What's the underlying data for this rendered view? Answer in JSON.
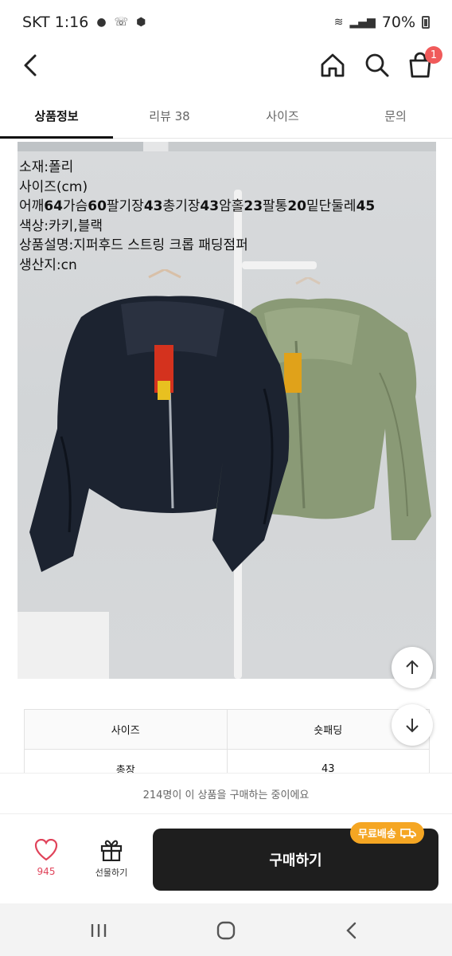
{
  "status_bar": {
    "carrier_time": "SKT 1:16",
    "battery": "70%"
  },
  "header": {
    "cart_count": "1"
  },
  "tabs": [
    {
      "label": "상품정보",
      "active": true
    },
    {
      "label": "리뷰 38",
      "active": false
    },
    {
      "label": "사이즈",
      "active": false
    },
    {
      "label": "문의",
      "active": false
    }
  ],
  "product_info": {
    "material": "소재:폴리",
    "size": "사이즈(cm)",
    "measure": {
      "l1": "어깨",
      "v1": "64",
      "l2": "가슴",
      "v2": "60",
      "l3": "팔기장",
      "v3": "43",
      "l4": "총기장",
      "v4": "43",
      "l5": "암홀",
      "v5": "23",
      "l6": "팔통",
      "v6": "20",
      "l7": "밑단둘레",
      "v7": "45"
    },
    "color": "색상:카키,블랙",
    "description": "상품설명:지퍼후드 스트링 크롭 패딩점퍼",
    "origin": "생산지:cn"
  },
  "size_table": {
    "headers": [
      "사이즈",
      "숏패딩"
    ],
    "rows": [
      [
        "총장",
        "43"
      ]
    ]
  },
  "viewer_banner": "214명이 이 상품을 구매하는 중이에요",
  "buy_bar": {
    "like_count": "945",
    "gift_label": "선물하기",
    "buy_label": "구매하기",
    "free_shipping": "무료배송"
  },
  "colors": {
    "accent_red": "#f05a5a",
    "badge_orange": "#f5a623",
    "buy_button": "#1e1e1e"
  }
}
